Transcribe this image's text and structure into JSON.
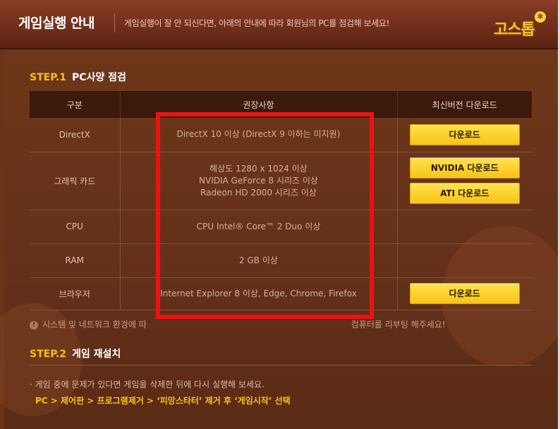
{
  "header": {
    "title": "게임실행 안내",
    "description": "게임실행이 잘 안 되신다면, 아래의 안내에 따라 회원님의 PC를 점검해 보세요!",
    "logo_text": "고스톱"
  },
  "step1": {
    "number": "STEP.1",
    "title": "PC사양 점검"
  },
  "table": {
    "headers": [
      "구분",
      "권장사항",
      "최신버전 다운로드"
    ],
    "rows": [
      {
        "label": "DirectX",
        "spec": [
          "DirectX 10 이상 (DirectX 9 이하는 미지원)"
        ],
        "buttons": [
          "다운로드"
        ]
      },
      {
        "label": "그래픽 카드",
        "spec": [
          "해상도 1280 x 1024 이상",
          "NVIDIA GeForce 8 시리즈 이상",
          "Radeon HD 2000 시리즈 이상"
        ],
        "buttons": [
          "NVIDIA 다운로드",
          "ATI 다운로드"
        ]
      },
      {
        "label": "CPU",
        "spec": [
          "CPU Intel® Core™ 2 Duo 이상"
        ],
        "buttons": []
      },
      {
        "label": "RAM",
        "spec": [
          "2 GB 이상"
        ],
        "buttons": []
      },
      {
        "label": "브라우저",
        "spec": [
          "Internet Explorer 8 이상, Edge, Chrome, Firefox"
        ],
        "buttons": [
          "다운로드"
        ]
      }
    ]
  },
  "notice": {
    "text_start": "시스템 및 네트워크 환경에 따",
    "text_end": "컴퓨터를 리부팅 해주세요!"
  },
  "step2": {
    "number": "STEP.2",
    "title": "게임 재설치",
    "description": "· 게임 중에 문제가 있다면 게임을 삭제한 뒤에 다시 실행해 보세요.",
    "path": "PC > 제어판 > 프로그램제거 > ‘피망스타터’ 제거 후 ‘게임시작’ 선택"
  },
  "colors": {
    "accent": "#f8bf1a",
    "header_bg": "#7a3520",
    "content_bg": "#6b3318",
    "table_header_bg": "#3b1a0c",
    "highlight_box": "#ee1111"
  }
}
